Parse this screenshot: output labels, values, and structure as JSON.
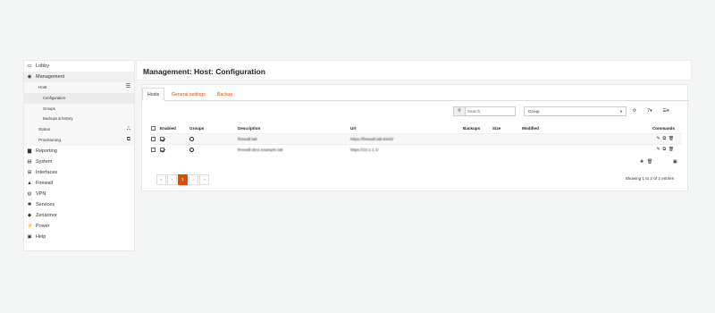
{
  "sidebar": {
    "items": [
      {
        "label": "Lobby",
        "icon": "laptop-icon"
      },
      {
        "label": "Management",
        "icon": "gauge-icon"
      },
      {
        "label": "Reporting",
        "icon": "chart-icon"
      },
      {
        "label": "System",
        "icon": "server-icon"
      },
      {
        "label": "Interfaces",
        "icon": "sitemap-icon"
      },
      {
        "label": "Firewall",
        "icon": "fire-icon"
      },
      {
        "label": "VPN",
        "icon": "globe-icon"
      },
      {
        "label": "Services",
        "icon": "gear-icon"
      },
      {
        "label": "Zenarmor",
        "icon": "shield-icon"
      },
      {
        "label": "Power",
        "icon": "plug-icon"
      },
      {
        "label": "Help",
        "icon": "help-icon"
      }
    ],
    "management_sub": {
      "host": "Host",
      "configuration": "Configuration",
      "groups": "Groups",
      "backups": "Backups & history",
      "status": "Status",
      "provisioning": "Provisioning"
    }
  },
  "header": {
    "title": "Management: Host: Configuration"
  },
  "tabs": [
    "Hosts",
    "General settings",
    "Backup"
  ],
  "toolbar": {
    "search_placeholder": "Search",
    "group_select": "Group",
    "refresh": "⟳",
    "page_size": "7▾",
    "columns": "☰▾"
  },
  "table": {
    "columns": [
      "Enabled",
      "Groups",
      "Description",
      "Url",
      "Backups",
      "Size",
      "Modified",
      "Commands"
    ],
    "rows": [
      {
        "description": "firewall.lab",
        "url": "https://firewall.lab:8443/"
      },
      {
        "description": "firewall-dmz.example.lab",
        "url": "https://10.1.1.1/"
      }
    ]
  },
  "pager": {
    "first": "«",
    "prev": "‹",
    "current": "1",
    "next": "›",
    "last": "»"
  },
  "footer": {
    "showing": "Showing 1 to 2 of 2 entries"
  }
}
